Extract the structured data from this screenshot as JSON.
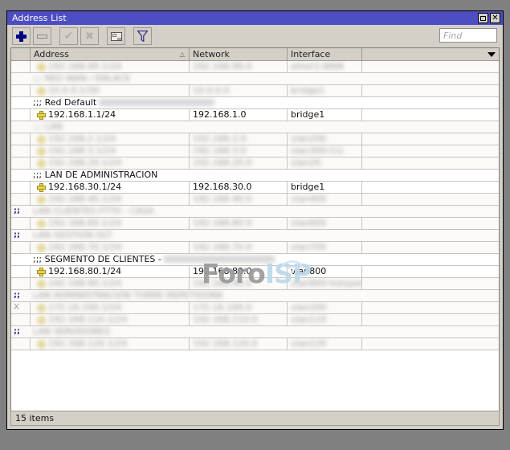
{
  "window": {
    "title": "Address List",
    "maximize_label": "□",
    "close_label": "✕"
  },
  "toolbar": {
    "add_label": "+",
    "remove_label": "−",
    "enable_label": "✓",
    "disable_label": "✗",
    "comment_label": "comment",
    "filter_label": "filter",
    "find_placeholder": "Find"
  },
  "columns": {
    "flag": "",
    "address": "Address",
    "network": "Network",
    "interface": "Interface",
    "extra": ""
  },
  "watermark": {
    "part1": "Foro",
    "part2": "ISP"
  },
  "status": {
    "items": "15 items"
  },
  "rows": [
    {
      "type": "entry",
      "flag": "",
      "address": "192.168.99.1/24",
      "network": "192.168.99.0",
      "interface": "ether1-WAN",
      "extra": "",
      "redacted": true
    },
    {
      "type": "comment",
      "flag": "",
      "comment": ";;; RED WAN / ENLACE",
      "redacted": true
    },
    {
      "type": "entry",
      "flag": "",
      "address": "10.0.0.1/30",
      "network": "10.0.0.0",
      "interface": "bridge1",
      "extra": "",
      "redacted": true
    },
    {
      "type": "comment",
      "flag": "",
      "comment": ";;; Red Default",
      "comment_redacted_tail": "RED A TODAS NUEVAS REDES",
      "redacted": false
    },
    {
      "type": "entry",
      "flag": "",
      "address": "192.168.1.1/24",
      "network": "192.168.1.0",
      "interface": "bridge1",
      "extra": "",
      "redacted": false
    },
    {
      "type": "comment",
      "flag": "",
      "comment": ";;; LAN",
      "redacted": true
    },
    {
      "type": "entry",
      "flag": "",
      "address": "192.168.2.1/24",
      "network": "192.168.2.0",
      "interface": "vlan200",
      "extra": "",
      "redacted": true
    },
    {
      "type": "entry",
      "flag": "",
      "address": "192.168.3.1/24",
      "network": "192.168.3.0",
      "interface": "vlan300-CLI",
      "extra": "",
      "redacted": true
    },
    {
      "type": "entry",
      "flag": "",
      "address": "192.168.20.1/24",
      "network": "192.168.20.0",
      "interface": "vlan20",
      "extra": "",
      "redacted": true
    },
    {
      "type": "comment",
      "flag": "",
      "comment": ";;; LAN DE ADMINISTRACION",
      "redacted": false
    },
    {
      "type": "entry",
      "flag": "",
      "address": "192.168.30.1/24",
      "network": "192.168.30.0",
      "interface": "bridge1",
      "extra": "",
      "redacted": false
    },
    {
      "type": "entry",
      "flag": "",
      "address": "192.168.40.1/24",
      "network": "192.168.40.0",
      "interface": "vlan400",
      "extra": "",
      "redacted": true
    },
    {
      "type": "comment",
      "flag": ";;",
      "comment": "LAN CLIENTES FTTH - CASA",
      "redacted": true
    },
    {
      "type": "entry",
      "flag": "",
      "address": "192.168.60.1/24",
      "network": "192.168.60.0",
      "interface": "vlan600",
      "extra": "",
      "redacted": true
    },
    {
      "type": "comment",
      "flag": ";;",
      "comment": "LAN GESTION OLT",
      "redacted": true
    },
    {
      "type": "entry",
      "flag": "",
      "address": "192.168.70.1/24",
      "network": "192.168.70.0",
      "interface": "vlan700",
      "extra": "",
      "redacted": true
    },
    {
      "type": "comment",
      "flag": "",
      "comment": ";;; SEGMENTO DE CLIENTES -",
      "comment_redacted_tail": "LAN PPPoE PARA CLIENTES",
      "redacted": false
    },
    {
      "type": "entry",
      "flag": "",
      "address": "192.168.80.1/24",
      "network": "192.168.80.0",
      "interface": "vlan800",
      "extra": "",
      "redacted": false
    },
    {
      "type": "entry",
      "flag": "",
      "address": "192.168.90.1/24",
      "network": "192.168.90.0",
      "interface": "vlan900-hotspot",
      "extra": "",
      "redacted": true
    },
    {
      "type": "comment",
      "flag": ";;",
      "comment": "LAN ADMINISTRACION TORRE REPETIDORA",
      "redacted": true
    },
    {
      "type": "entry",
      "flag": "X",
      "address": "172.16.100.1/24",
      "network": "172.16.100.0",
      "interface": "vlan100",
      "extra": "",
      "redacted": true
    },
    {
      "type": "entry",
      "flag": "",
      "address": "192.168.110.1/24",
      "network": "192.168.110.0",
      "interface": "vlan110",
      "extra": "",
      "redacted": true
    },
    {
      "type": "comment",
      "flag": ";;",
      "comment": "LAN SERVIDORES",
      "redacted": true
    },
    {
      "type": "entry",
      "flag": "",
      "address": "192.168.120.1/24",
      "network": "192.168.120.0",
      "interface": "vlan120",
      "extra": "",
      "redacted": true
    }
  ]
}
